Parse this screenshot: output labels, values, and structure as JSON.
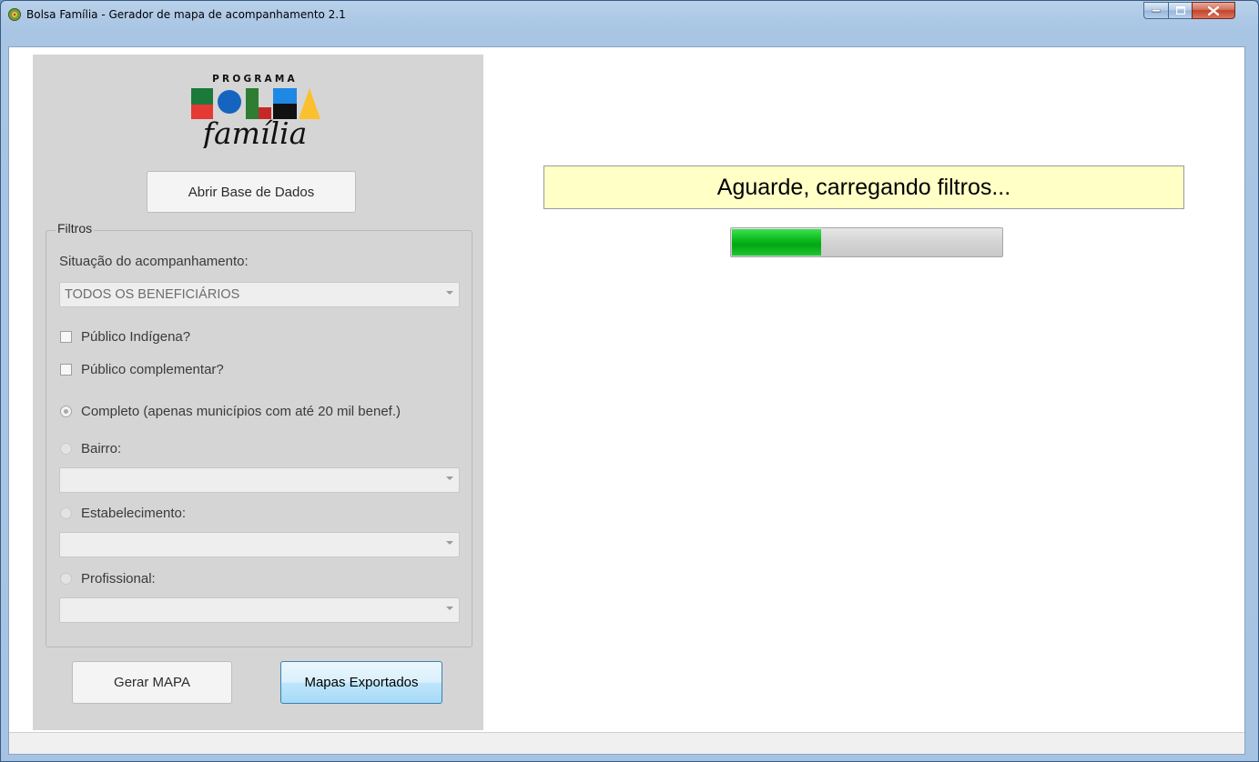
{
  "window": {
    "title": "Bolsa Família - Gerador de mapa de acompanhamento 2.1",
    "icon": "bolsa-familia-app-icon",
    "controls": {
      "minimize_icon": "minimize-icon",
      "maximize_icon": "maximize-icon",
      "close_icon": "close-icon"
    }
  },
  "logo": {
    "top_text": "PROGRAMA",
    "brand_letters": "BOLSA",
    "script_text": "família"
  },
  "left_panel": {
    "open_db_button": "Abrir Base de Dados",
    "filters": {
      "legend": "Filtros",
      "situation_label": "Situação do acompanhamento:",
      "situation_value": "TODOS OS BENEFICIÁRIOS",
      "indigenous_label": "Público Indígena?",
      "indigenous_checked": false,
      "complementary_label": "Público complementar?",
      "complementary_checked": false,
      "complete_label": "Completo (apenas municípios com até 20 mil benef.)",
      "complete_selected": true,
      "neighborhood_label": "Bairro:",
      "neighborhood_value": "",
      "establishment_label": "Estabelecimento:",
      "establishment_value": "",
      "professional_label": "Profissional:",
      "professional_value": ""
    },
    "generate_button": "Gerar MAPA",
    "exported_button": "Mapas Exportados"
  },
  "main": {
    "loading_message": "Aguarde, carregando filtros...",
    "progress_percent": 33
  },
  "colors": {
    "loading_bg": "#ffffc6",
    "progress_green": "#06b61a",
    "panel_bg": "#d5d5d5"
  }
}
